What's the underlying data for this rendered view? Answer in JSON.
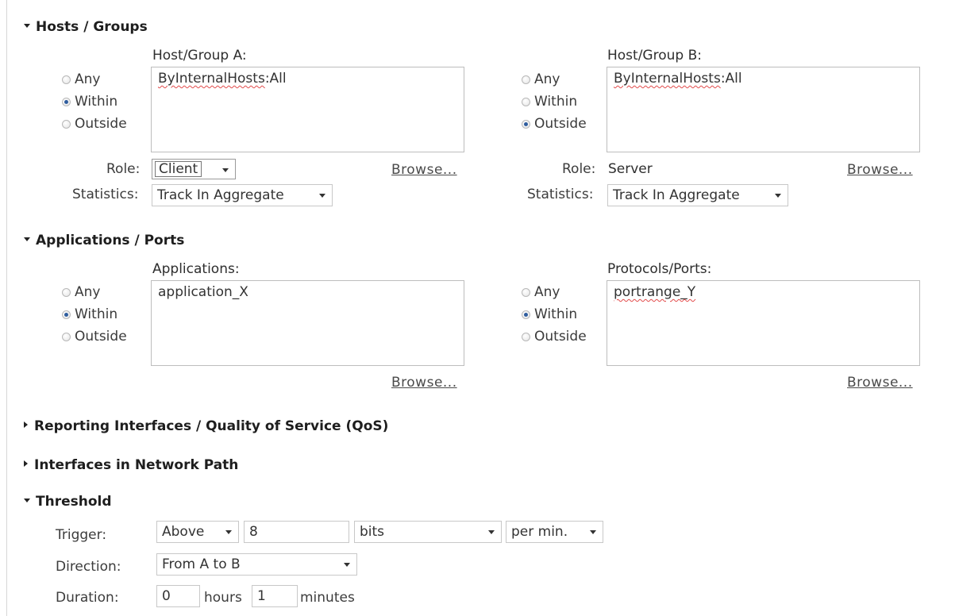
{
  "hosts_groups": {
    "title": "Hosts / Groups",
    "group_a": {
      "label": "Host/Group A:",
      "radios": [
        {
          "label": "Any",
          "checked": false
        },
        {
          "label": "Within",
          "checked": true
        },
        {
          "label": "Outside",
          "checked": false
        }
      ],
      "value_prefix": "ByInternalHosts",
      "value_suffix": ":All",
      "role_label": "Role:",
      "role_value": "Client",
      "browse": "Browse...",
      "stats_label": "Statistics:",
      "stats_value": "Track In Aggregate"
    },
    "group_b": {
      "label": "Host/Group B:",
      "radios": [
        {
          "label": "Any",
          "checked": false
        },
        {
          "label": "Within",
          "checked": false
        },
        {
          "label": "Outside",
          "checked": true
        }
      ],
      "value_prefix": "ByInternalHosts",
      "value_suffix": ":All",
      "role_label": "Role:",
      "role_value": "Server",
      "browse": "Browse...",
      "stats_label": "Statistics:",
      "stats_value": "Track In Aggregate"
    }
  },
  "applications_ports": {
    "title": "Applications / Ports",
    "apps": {
      "label": "Applications:",
      "radios": [
        {
          "label": "Any",
          "checked": false
        },
        {
          "label": "Within",
          "checked": true
        },
        {
          "label": "Outside",
          "checked": false
        }
      ],
      "value": "application_X",
      "browse": "Browse..."
    },
    "ports": {
      "label": "Protocols/Ports:",
      "radios": [
        {
          "label": "Any",
          "checked": false
        },
        {
          "label": "Within",
          "checked": true
        },
        {
          "label": "Outside",
          "checked": false
        }
      ],
      "value": "portrange_Y",
      "browse": "Browse..."
    }
  },
  "reporting": {
    "title": "Reporting Interfaces / Quality of Service (QoS)"
  },
  "interfaces_path": {
    "title": "Interfaces in Network Path"
  },
  "threshold": {
    "title": "Threshold",
    "trigger_label": "Trigger:",
    "trigger_op": "Above",
    "trigger_value": "8",
    "trigger_unit": "bits",
    "trigger_rate": "per min.",
    "direction_label": "Direction:",
    "direction_value": "From A to B",
    "duration_label": "Duration:",
    "duration_hours": "0",
    "hours_label": "hours",
    "duration_minutes": "1",
    "minutes_label": "minutes"
  },
  "colors": {
    "radio_selected": "#2f5d9e",
    "spellcheck": "#e24b4b"
  },
  "icons": {
    "expanded": "triangle-down-icon",
    "collapsed": "triangle-right-icon",
    "dropdown": "chevron-down-icon"
  }
}
